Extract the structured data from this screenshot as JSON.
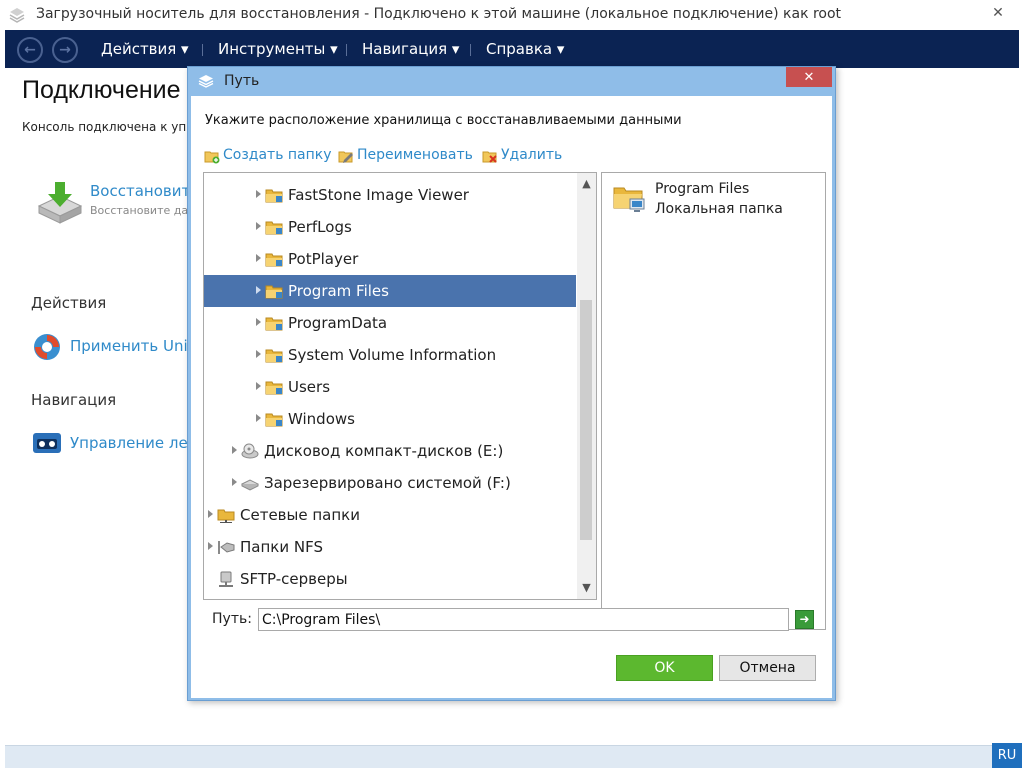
{
  "window": {
    "title": "Загрузочный носитель для восстановления - Подключено к этой машине (локальное подключение) как root",
    "close_glyph": "✕"
  },
  "toolbar": {
    "back_glyph": "←",
    "forward_glyph": "→",
    "menus": [
      {
        "label": "Действия ▾"
      },
      {
        "label": "Инструменты ▾"
      },
      {
        "label": "Навигация ▾"
      },
      {
        "label": "Справка ▾"
      }
    ]
  },
  "main": {
    "title": "Подключение",
    "subtitle": "Консоль подключена к управ",
    "recover_link": "Восстановит",
    "recover_desc": "Восстановите данн",
    "actions_heading": "Действия",
    "apply_link": "Применить Univ",
    "nav_heading": "Навигация",
    "tape_link": "Управление лен"
  },
  "statusbar": {
    "lang": "RU"
  },
  "dialog": {
    "title": "Путь",
    "close_glyph": "✕",
    "instruction": "Укажите расположение хранилища с восстанавливаемыми данными",
    "actions": {
      "create_folder": "Создать папку",
      "rename": "Переименовать",
      "delete": "Удалить"
    },
    "tree": [
      {
        "label": "FastStone Image Viewer",
        "icon": "folder-icon",
        "selected": false
      },
      {
        "label": "PerfLogs",
        "icon": "folder-icon",
        "selected": false
      },
      {
        "label": "PotPlayer",
        "icon": "folder-icon",
        "selected": false
      },
      {
        "label": "Program Files",
        "icon": "folder-icon",
        "selected": true
      },
      {
        "label": "ProgramData",
        "icon": "folder-icon",
        "selected": false
      },
      {
        "label": "System Volume Information",
        "icon": "folder-icon",
        "selected": false
      },
      {
        "label": "Users",
        "icon": "folder-icon",
        "selected": false
      },
      {
        "label": "Windows",
        "icon": "folder-icon",
        "selected": false
      },
      {
        "label": "Дисковод компакт-дисков (E:)",
        "icon": "cd-drive-icon",
        "selected": false
      },
      {
        "label": "Зарезервировано системой (F:)",
        "icon": "drive-icon",
        "selected": false
      },
      {
        "label": "Сетевые папки",
        "icon": "network-folder-icon",
        "selected": false
      },
      {
        "label": "Папки NFS",
        "icon": "nfs-icon",
        "selected": false
      },
      {
        "label": "SFTP-серверы",
        "icon": "sftp-icon",
        "selected": false
      }
    ],
    "scroll_up_glyph": "▲",
    "scroll_down_glyph": "▼",
    "info": {
      "name": "Program Files",
      "type": "Локальная папка"
    },
    "path": {
      "label": "Путь:",
      "value": "C:\\Program Files\\",
      "go_glyph": "➜"
    },
    "ok_label": "OK",
    "cancel_label": "Отмена"
  },
  "colors": {
    "toolbar_bg": "#0b2353",
    "link": "#2f8ac9",
    "selection": "#4a73ad",
    "ok_button": "#5cb82f",
    "dialog_frame": "#8fbde8",
    "dialog_close": "#c75050",
    "lang_badge": "#1f6fbd"
  }
}
